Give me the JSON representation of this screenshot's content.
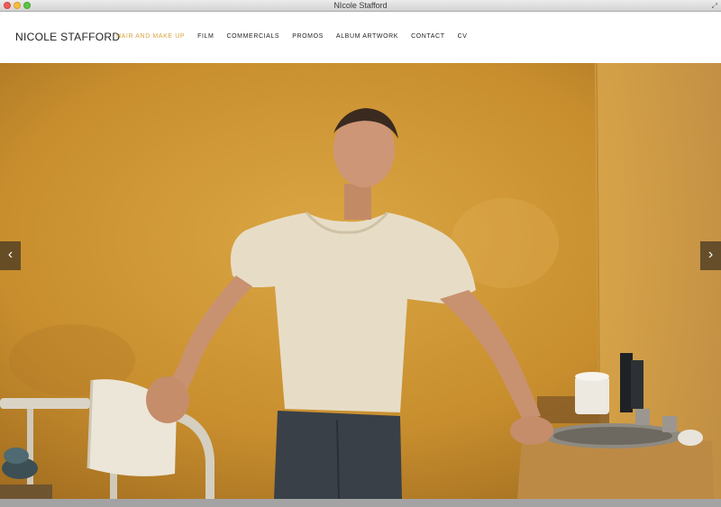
{
  "window": {
    "title": "NIcole Stafford"
  },
  "site": {
    "logo": "NICOLE STAFFORD"
  },
  "nav": {
    "items": [
      {
        "label": "HAIR AND MAKE UP",
        "active": true
      },
      {
        "label": "FILM",
        "active": false
      },
      {
        "label": "COMMERCIALS",
        "active": false
      },
      {
        "label": "PROMOS",
        "active": false
      },
      {
        "label": "ALBUM ARTWORK",
        "active": false
      },
      {
        "label": "CONTACT",
        "active": false
      },
      {
        "label": "CV",
        "active": false
      }
    ]
  },
  "slideshow": {
    "prev_icon": "‹",
    "next_icon": "›"
  },
  "colors": {
    "accent": "#d9a440",
    "text": "#222222",
    "wall": "#c98d2b"
  }
}
